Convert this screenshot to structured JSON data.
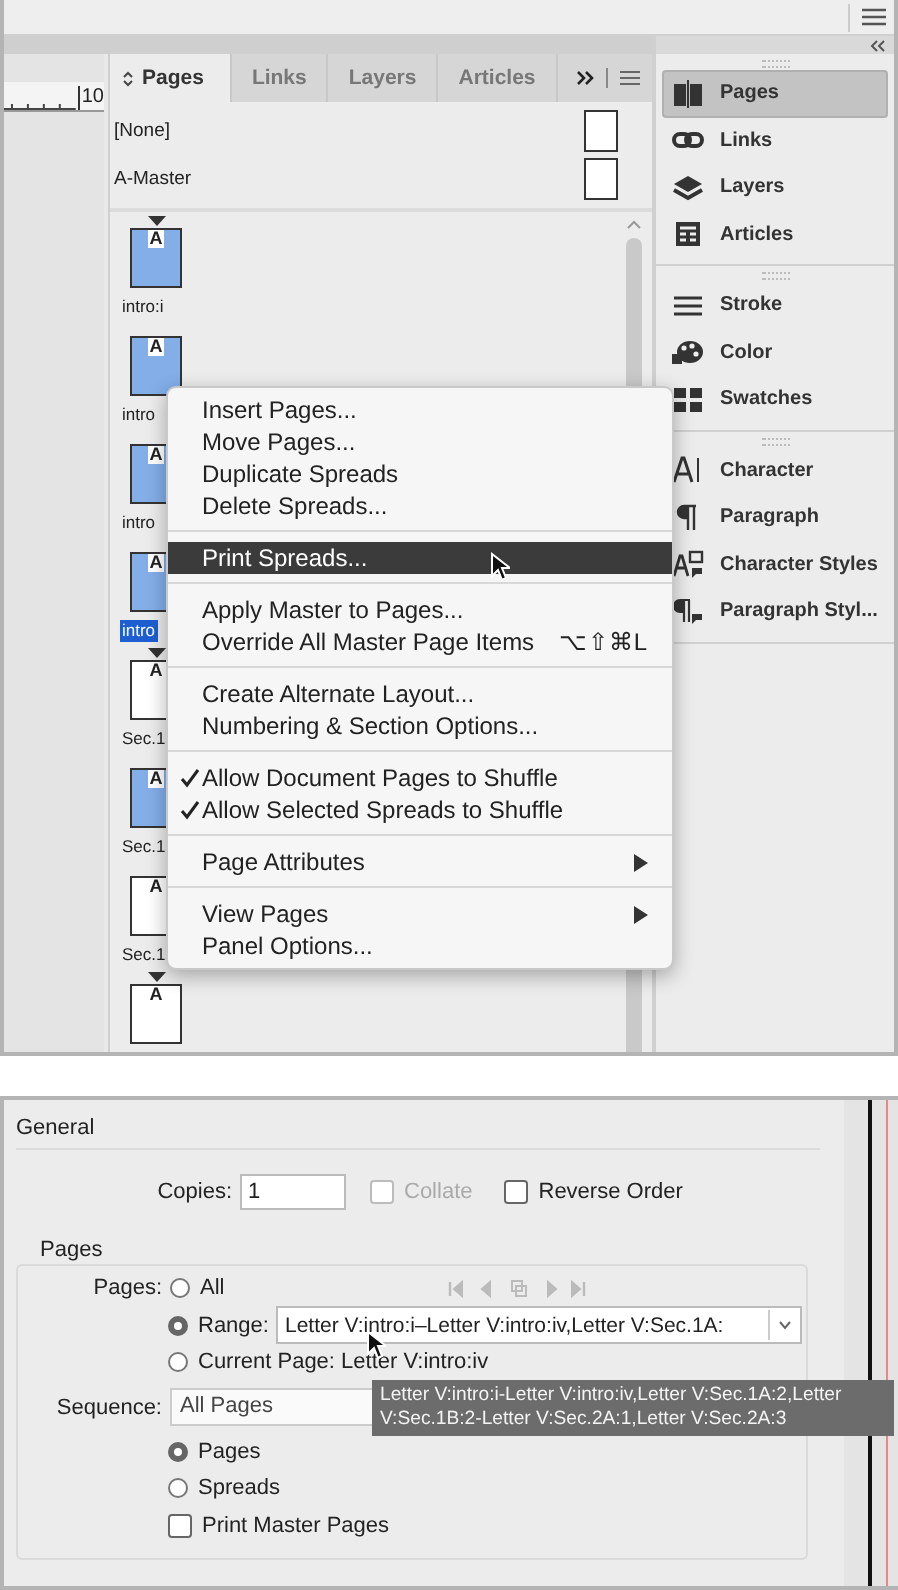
{
  "ruler": {
    "label": "10"
  },
  "pages_panel": {
    "tabs": [
      {
        "label": "Pages",
        "selected": true
      },
      {
        "label": "Links",
        "selected": false
      },
      {
        "label": "Layers",
        "selected": false
      },
      {
        "label": "Articles",
        "selected": false
      }
    ],
    "masters": [
      {
        "label": "[None]"
      },
      {
        "label": "A-Master"
      }
    ],
    "pages": [
      {
        "label": "intro:i",
        "master": "A",
        "highlighted": true,
        "section_start": true,
        "selected": false
      },
      {
        "label": "intro",
        "master": "A",
        "highlighted": true,
        "section_start": false,
        "selected": false
      },
      {
        "label": "intro",
        "master": "A",
        "highlighted": true,
        "section_start": false,
        "selected": false
      },
      {
        "label": "intro",
        "master": "A",
        "highlighted": true,
        "section_start": false,
        "selected": true
      },
      {
        "label": "Sec.1",
        "master": "A",
        "highlighted": false,
        "section_start": true,
        "selected": false
      },
      {
        "label": "Sec.1",
        "master": "A",
        "highlighted": true,
        "section_start": false,
        "selected": false
      },
      {
        "label": "Sec.1",
        "master": "A",
        "highlighted": false,
        "section_start": false,
        "selected": false
      },
      {
        "master": "A",
        "highlighted": false,
        "section_start": true,
        "selected": false
      }
    ]
  },
  "context_menu": {
    "groups": [
      {
        "items": [
          {
            "label": "Insert Pages...",
            "checked": false,
            "selected": false,
            "submenu": false
          },
          {
            "label": "Move Pages...",
            "checked": false,
            "selected": false,
            "submenu": false
          },
          {
            "label": "Duplicate Spreads",
            "checked": false,
            "selected": false,
            "submenu": false
          },
          {
            "label": "Delete Spreads...",
            "checked": false,
            "selected": false,
            "submenu": false
          }
        ]
      },
      {
        "items": [
          {
            "label": "Print Spreads...",
            "checked": false,
            "selected": true,
            "submenu": false
          }
        ]
      },
      {
        "items": [
          {
            "label": "Apply Master to Pages...",
            "checked": false,
            "selected": false,
            "submenu": false
          },
          {
            "label": "Override All Master Page Items",
            "shortcut": "⌥⇧⌘L",
            "checked": false,
            "selected": false,
            "submenu": false
          }
        ]
      },
      {
        "items": [
          {
            "label": "Create Alternate Layout...",
            "checked": false,
            "selected": false,
            "submenu": false
          },
          {
            "label": "Numbering & Section Options...",
            "checked": false,
            "selected": false,
            "submenu": false
          }
        ]
      },
      {
        "items": [
          {
            "label": "Allow Document Pages to Shuffle",
            "checked": true,
            "selected": false,
            "submenu": false
          },
          {
            "label": "Allow Selected Spreads to Shuffle",
            "checked": true,
            "selected": false,
            "submenu": false
          }
        ]
      },
      {
        "items": [
          {
            "label": "Page Attributes",
            "checked": false,
            "selected": false,
            "submenu": true
          }
        ]
      },
      {
        "items": [
          {
            "label": "View Pages",
            "checked": false,
            "selected": false,
            "submenu": true
          },
          {
            "label": "Panel Options...",
            "checked": false,
            "selected": false,
            "submenu": false
          }
        ]
      }
    ]
  },
  "dock": {
    "groups": [
      {
        "items": [
          {
            "label": "Pages",
            "selected": true
          },
          {
            "label": "Links",
            "selected": false
          },
          {
            "label": "Layers",
            "selected": false
          },
          {
            "label": "Articles",
            "selected": false
          }
        ]
      },
      {
        "items": [
          {
            "label": "Stroke",
            "selected": false
          },
          {
            "label": "Color",
            "selected": false
          },
          {
            "label": "Swatches",
            "selected": false
          }
        ]
      },
      {
        "items": [
          {
            "label": "Character",
            "selected": false
          },
          {
            "label": "Paragraph",
            "selected": false
          },
          {
            "label": "Character Styles",
            "selected": false
          },
          {
            "label": "Paragraph Styl...",
            "selected": false
          }
        ]
      }
    ]
  },
  "print_dialog": {
    "section": "General",
    "copies": {
      "label": "Copies:",
      "value": "1"
    },
    "collate": {
      "label": "Collate",
      "checked": false,
      "disabled": true
    },
    "reverse_order": {
      "label": "Reverse Order",
      "checked": false,
      "disabled": false
    },
    "pages_group": {
      "title": "Pages",
      "label": "Pages:",
      "options": [
        {
          "label": "All",
          "selected": false
        },
        {
          "label": "Range:",
          "selected": true,
          "value": "Letter V:intro:i–Letter V:intro:iv,Letter V:Sec.1A:"
        },
        {
          "label": "Current Page: Letter V:intro:iv",
          "selected": false
        }
      ],
      "sequence": {
        "label": "Sequence:",
        "value": "All Pages"
      },
      "layout": [
        {
          "label": "Pages",
          "selected": true
        },
        {
          "label": "Spreads",
          "selected": false
        }
      ],
      "print_master_pages": {
        "label": "Print Master Pages",
        "checked": false
      }
    },
    "tooltip": "Letter V:intro:i-Letter V:intro:iv,Letter V:Sec.1A:2,Letter V:Sec.1B:2-Letter V:Sec.2A:1,Letter V:Sec.2A:3"
  }
}
